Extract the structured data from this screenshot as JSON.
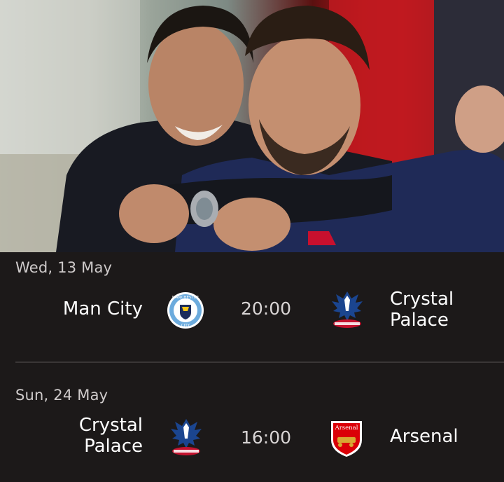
{
  "colors": {
    "panel_background": "#1c1919",
    "divider": "#3a3636",
    "date_text": "#cfcbcb",
    "team_text": "#ffffff",
    "time_text": "#d8d4d4",
    "arsenal_red": "#db0007",
    "palace_blue": "#1b458f",
    "city_blue": "#6cabdd"
  },
  "hero": {
    "image_description_icon": "photo-two-men-hugging"
  },
  "fixtures": [
    {
      "date": "Wed, 13 May",
      "home_team": "Man City",
      "home_crest_icon": "manchester-city-crest-icon",
      "home_crest_text_top": "MANCHESTER",
      "home_crest_text_bottom": "CITY",
      "time": "20:00",
      "away_team_line1": "Crystal",
      "away_team_line2": "Palace",
      "away_crest_icon": "crystal-palace-crest-icon"
    },
    {
      "date": "Sun, 24 May",
      "home_team_line1": "Crystal",
      "home_team_line2": "Palace",
      "home_crest_icon": "crystal-palace-crest-icon",
      "time": "16:00",
      "away_team": "Arsenal",
      "away_crest_icon": "arsenal-crest-icon",
      "away_crest_text": "Arsenal"
    }
  ]
}
